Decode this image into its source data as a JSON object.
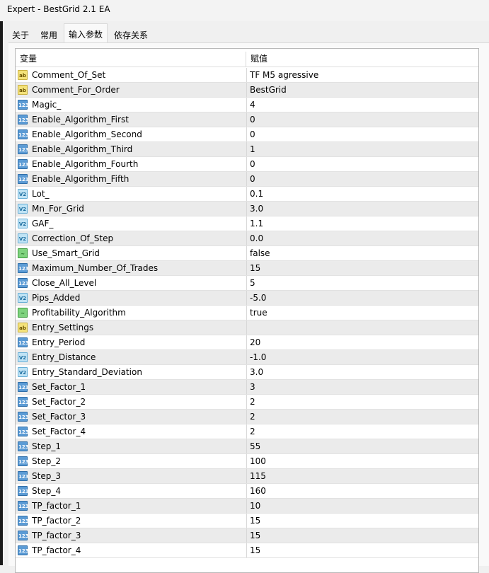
{
  "window": {
    "title": "Expert - BestGrid 2.1 EA"
  },
  "tabs": [
    {
      "label": "关于"
    },
    {
      "label": "常用"
    },
    {
      "label": "输入参数"
    },
    {
      "label": "依存关系"
    }
  ],
  "table": {
    "headers": {
      "name": "变量",
      "value": "赋值"
    },
    "rows": [
      {
        "type": "string",
        "icon": "ab",
        "name": "Comment_Of_Set",
        "value": "TF M5 agressive"
      },
      {
        "type": "string",
        "icon": "ab",
        "name": "Comment_For_Order",
        "value": "BestGrid"
      },
      {
        "type": "int",
        "icon": "123",
        "name": "Magic_",
        "value": "4"
      },
      {
        "type": "int",
        "icon": "123",
        "name": "Enable_Algorithm_First",
        "value": "0"
      },
      {
        "type": "int",
        "icon": "123",
        "name": "Enable_Algorithm_Second",
        "value": "0"
      },
      {
        "type": "int",
        "icon": "123",
        "name": "Enable_Algorithm_Third",
        "value": "1"
      },
      {
        "type": "int",
        "icon": "123",
        "name": "Enable_Algorithm_Fourth",
        "value": "0"
      },
      {
        "type": "int",
        "icon": "123",
        "name": "Enable_Algorithm_Fifth",
        "value": "0"
      },
      {
        "type": "double",
        "icon": "V2",
        "name": "Lot_",
        "value": "0.1"
      },
      {
        "type": "double",
        "icon": "V2",
        "name": "Mn_For_Grid",
        "value": "3.0"
      },
      {
        "type": "double",
        "icon": "V2",
        "name": "GAF_",
        "value": "1.1"
      },
      {
        "type": "double",
        "icon": "V2",
        "name": "Correction_Of_Step",
        "value": "0.0"
      },
      {
        "type": "bool",
        "icon": "~",
        "name": "Use_Smart_Grid",
        "value": "false"
      },
      {
        "type": "int",
        "icon": "123",
        "name": "Maximum_Number_Of_Trades",
        "value": "15"
      },
      {
        "type": "int",
        "icon": "123",
        "name": "Close_All_Level",
        "value": "5"
      },
      {
        "type": "double",
        "icon": "V2",
        "name": "Pips_Added",
        "value": "-5.0"
      },
      {
        "type": "bool",
        "icon": "~",
        "name": "Profitability_Algorithm",
        "value": "true"
      },
      {
        "type": "string",
        "icon": "ab",
        "name": "Entry_Settings",
        "value": ""
      },
      {
        "type": "int",
        "icon": "123",
        "name": "Entry_Period",
        "value": "20"
      },
      {
        "type": "double",
        "icon": "V2",
        "name": "Entry_Distance",
        "value": "-1.0"
      },
      {
        "type": "double",
        "icon": "V2",
        "name": "Entry_Standard_Deviation",
        "value": "3.0"
      },
      {
        "type": "int",
        "icon": "123",
        "name": "Set_Factor_1",
        "value": "3"
      },
      {
        "type": "int",
        "icon": "123",
        "name": "Set_Factor_2",
        "value": "2"
      },
      {
        "type": "int",
        "icon": "123",
        "name": "Set_Factor_3",
        "value": "2"
      },
      {
        "type": "int",
        "icon": "123",
        "name": "Set_Factor_4",
        "value": "2"
      },
      {
        "type": "int",
        "icon": "123",
        "name": "Step_1",
        "value": "55"
      },
      {
        "type": "int",
        "icon": "123",
        "name": "Step_2",
        "value": "100"
      },
      {
        "type": "int",
        "icon": "123",
        "name": "Step_3",
        "value": "115"
      },
      {
        "type": "int",
        "icon": "123",
        "name": "Step_4",
        "value": "160"
      },
      {
        "type": "int",
        "icon": "123",
        "name": "TP_factor_1",
        "value": "10"
      },
      {
        "type": "int",
        "icon": "123",
        "name": "TP_factor_2",
        "value": "15"
      },
      {
        "type": "int",
        "icon": "123",
        "name": "TP_factor_3",
        "value": "15"
      },
      {
        "type": "int",
        "icon": "123",
        "name": "TP_factor_4",
        "value": "15"
      }
    ]
  }
}
